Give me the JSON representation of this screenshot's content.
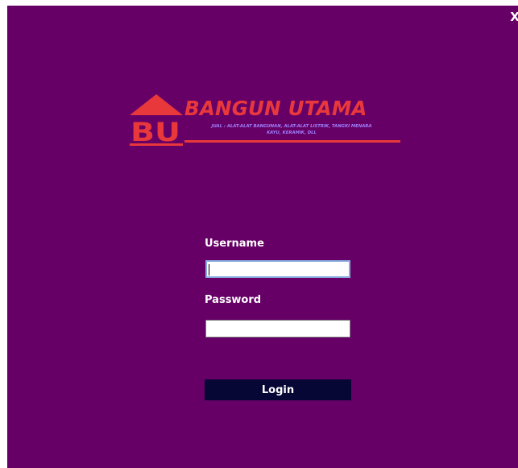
{
  "window": {
    "close_label": "X",
    "background_color": "#660066"
  },
  "logo": {
    "mark_text": "BU",
    "title": "BANGUN UTAMA",
    "tagline": "JUAL : ALAT-ALAT BANGUNAN, ALAT-ALAT LISTRIK, TANGKI MENARA\nKAYU, KERAMIK, DLL",
    "accent_color": "#e8383b",
    "tagline_color": "#a080ff"
  },
  "form": {
    "username_label": "Username",
    "username_value": "",
    "password_label": "Password",
    "password_value": "",
    "login_label": "Login",
    "button_color": "#070735",
    "focus_border_color": "#88aadd"
  }
}
